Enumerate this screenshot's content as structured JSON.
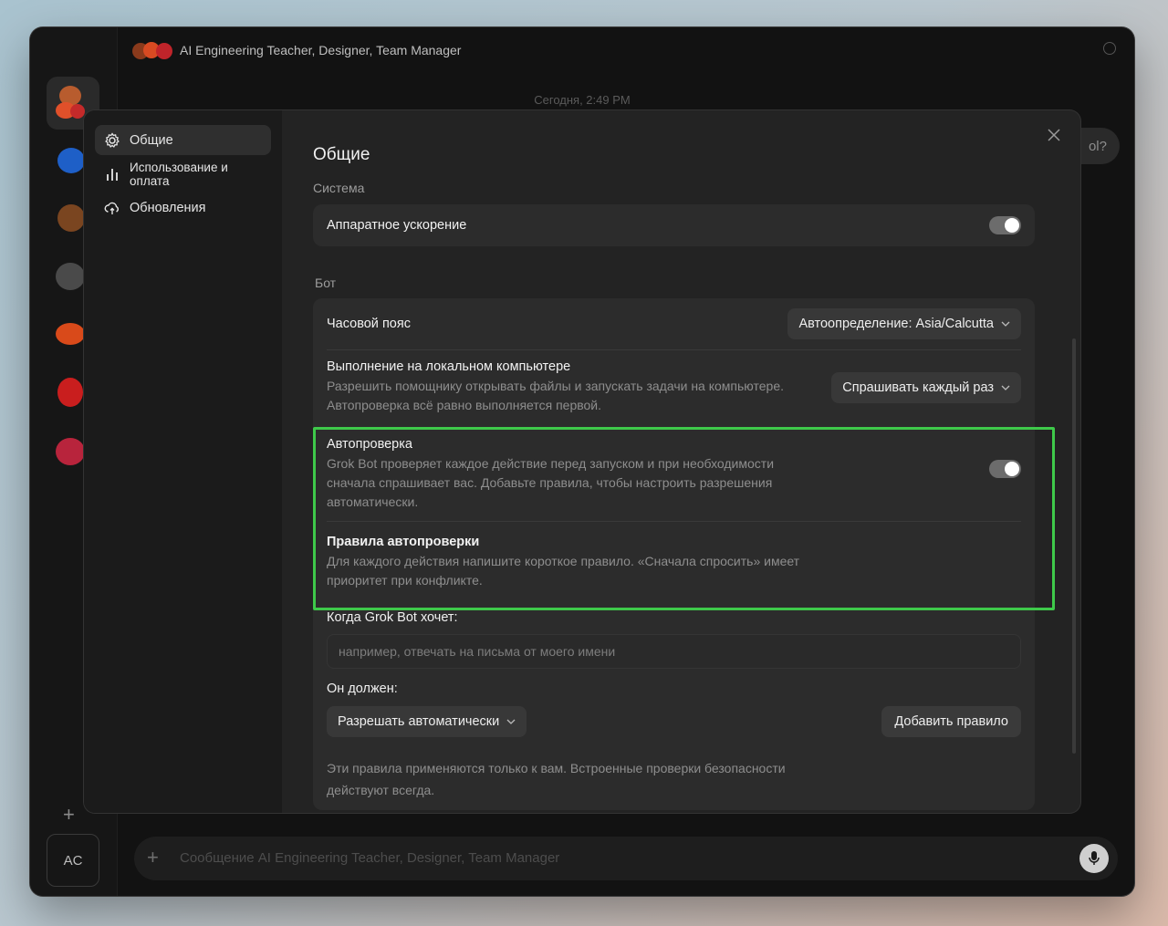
{
  "app": {
    "title": "AI Engineering Teacher, Designer, Team Manager",
    "date_label": "Сегодня, 2:49 PM",
    "bubble_text": "ol?",
    "composer_placeholder": "Сообщение AI Engineering Teacher, Designer, Team Manager",
    "user_initials": "AC"
  },
  "settings": {
    "nav": [
      {
        "label": "Общие",
        "icon": "gear-icon",
        "active": true
      },
      {
        "label": "Использование и оплата",
        "icon": "bar-chart-icon",
        "active": false
      },
      {
        "label": "Обновления",
        "icon": "cloud-sync-icon",
        "active": false
      }
    ],
    "title": "Общие",
    "system": {
      "section_label": "Система",
      "hw_accel_label": "Аппаратное ускорение",
      "hw_accel_on": true
    },
    "bot": {
      "section_label": "Бот",
      "timezone_label": "Часовой пояс",
      "timezone_value": "Автоопределение: Asia/Calcutta",
      "local_exec_label": "Выполнение на локальном компьютере",
      "local_exec_desc": "Разрешить помощнику открывать файлы и запускать задачи на компьютере. Автопроверка всё равно выполняется первой.",
      "local_exec_value": "Спрашивать каждый раз",
      "autocheck_label": "Автопроверка",
      "autocheck_desc": "Grok Bot проверяет каждое действие перед запуском и при необходимости сначала спрашивает вас. Добавьте правила, чтобы настроить разрешения автоматически.",
      "autocheck_on": true,
      "rules_label": "Правила автопроверки",
      "rules_desc": "Для каждого действия напишите короткое правило. «Сначала спросить» имеет приоритет при конфликте.",
      "when_label": "Когда Grok Bot хочет:",
      "when_placeholder": "например, отвечать на письма от моего имени",
      "should_label": "Он должен:",
      "should_value": "Разрешать автоматически",
      "add_rule_label": "Добавить правило",
      "footnote": "Эти правила применяются только к вам. Встроенные проверки безопасности действуют всегда."
    }
  },
  "colors": {
    "highlight": "#3ec94a",
    "window_bg": "#121212",
    "modal_bg": "#232323"
  }
}
